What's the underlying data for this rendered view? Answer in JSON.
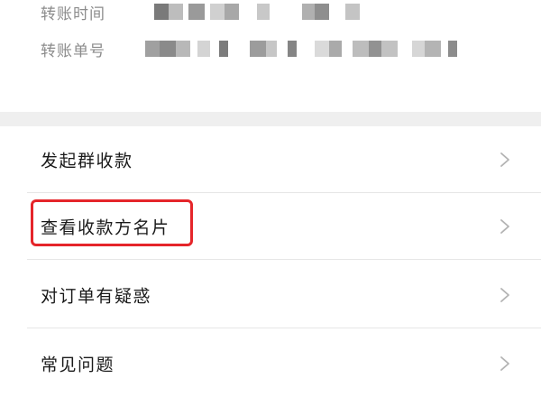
{
  "transfer_info": {
    "time_label": "转账时间",
    "number_label": "转账单号"
  },
  "menu": {
    "items": [
      {
        "label": "发起群收款"
      },
      {
        "label": "查看收款方名片"
      },
      {
        "label": "对订单有疑惑"
      },
      {
        "label": "常见问题"
      }
    ]
  },
  "colors": {
    "highlight": "#e5252a",
    "label_gray": "#8c8c8c",
    "text": "#1a1a1a",
    "divider": "#efefef",
    "chevron": "#b3b3b3"
  },
  "icons": {
    "row_arrow": "chevron-right-icon"
  }
}
